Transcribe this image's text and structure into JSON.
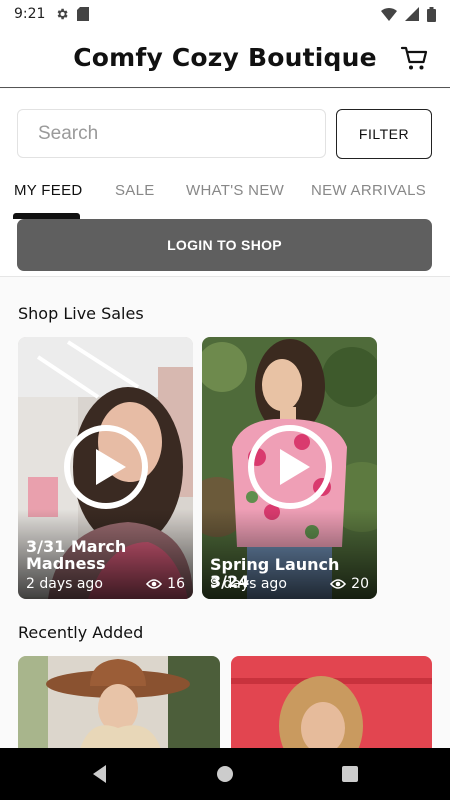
{
  "status_bar": {
    "time": "9:21",
    "left_icons": [
      "gear-icon",
      "sd-card-icon"
    ],
    "right_icons": [
      "wifi-icon",
      "signal-icon",
      "battery-icon"
    ]
  },
  "header": {
    "title": "Comfy Cozy Boutique",
    "cart_icon": "cart-icon"
  },
  "search": {
    "placeholder": "Search",
    "value": ""
  },
  "filter": {
    "label": "FILTER"
  },
  "tabs": [
    {
      "label": "MY FEED",
      "active": true
    },
    {
      "label": "SALE",
      "active": false
    },
    {
      "label": "WHAT'S NEW",
      "active": false
    },
    {
      "label": "NEW ARRIVALS",
      "active": false
    }
  ],
  "login_button": {
    "label": "LOGIN TO SHOP"
  },
  "live_sales": {
    "title": "Shop Live Sales",
    "items": [
      {
        "title": "3/31 March Madness",
        "age": "2 days ago",
        "views": "16"
      },
      {
        "title": "Spring Launch 3/24",
        "age": "9 days ago",
        "views": "20"
      }
    ]
  },
  "recently_added": {
    "title": "Recently Added"
  },
  "colors": {
    "accent": "#111111",
    "login_button_bg": "#5f5f5f",
    "tab_inactive": "#888888"
  }
}
